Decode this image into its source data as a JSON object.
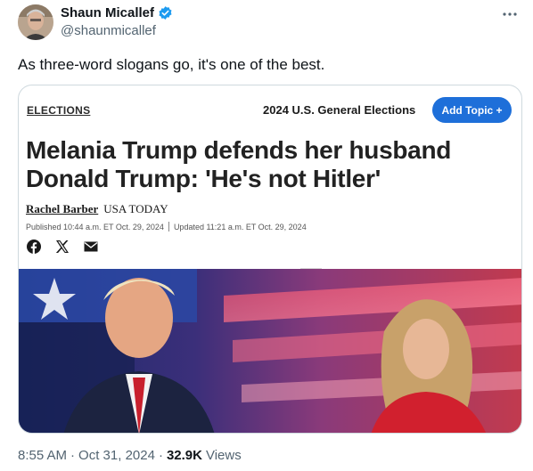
{
  "tweet": {
    "author_name": "Shaun Micallef",
    "author_handle": "@shaunmicallef",
    "text": "As three-word slogans go, it's one of the best.",
    "time": "8:55 AM",
    "separator": "·",
    "date": "Oct 31, 2024",
    "views_count": "32.9K",
    "views_label": "Views"
  },
  "card": {
    "section_link": "ELECTIONS",
    "section_title": "2024 U.S. General Elections",
    "add_topic_label": "Add Topic +",
    "headline": "Melania Trump defends her husband Donald Trump: 'He's not Hitler'",
    "author": "Rachel Barber",
    "publisher": "USA TODAY",
    "published": "Published 10:44 a.m. ET Oct. 29, 2024",
    "updated": "Updated 11:21 a.m. ET Oct. 29, 2024",
    "share_icons": [
      "facebook-icon",
      "x-icon",
      "email-icon"
    ]
  },
  "colors": {
    "verified": "#1d9bf0",
    "add_topic": "#1e6fd9",
    "muted": "#536471"
  }
}
